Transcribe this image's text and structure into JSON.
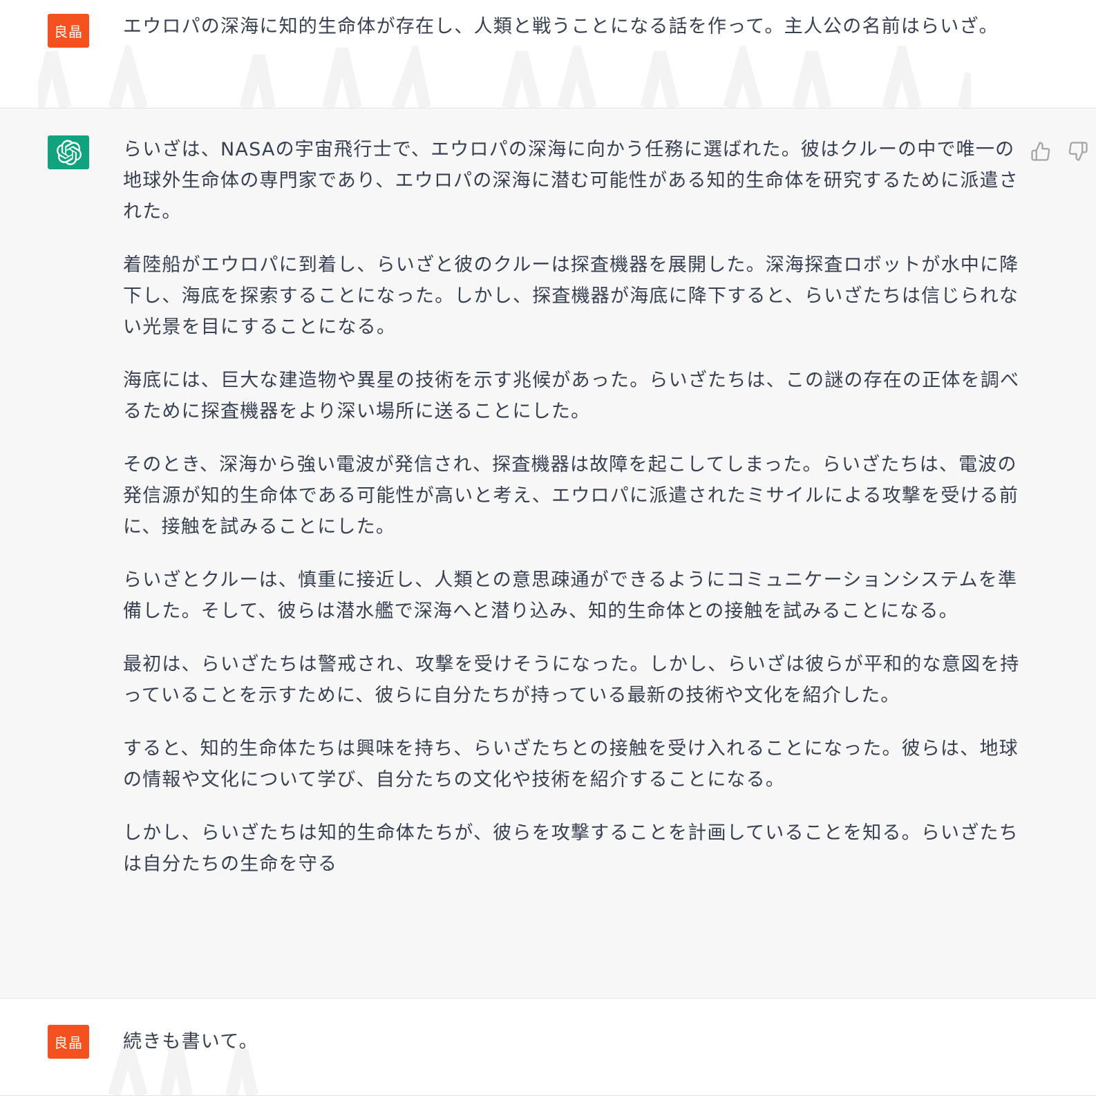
{
  "user_avatar_label": "良晶",
  "colors": {
    "user_avatar": "#f4511e",
    "assistant_avatar": "#10a37f",
    "assistant_bg": "#f7f7f8",
    "text": "#374151"
  },
  "messages": [
    {
      "role": "user",
      "text": "エウロパの深海に知的生命体が存在し、人類と戦うことになる話を作って。主人公の名前はらいざ。"
    },
    {
      "role": "assistant",
      "paragraphs": [
        "らいざは、NASAの宇宙飛行士で、エウロパの深海に向かう任務に選ばれた。彼はクルーの中で唯一の地球外生命体の専門家であり、エウロパの深海に潜む可能性がある知的生命体を研究するために派遣された。",
        "着陸船がエウロパに到着し、らいざと彼のクルーは探査機器を展開した。深海探査ロボットが水中に降下し、海底を探索することになった。しかし、探査機器が海底に降下すると、らいざたちは信じられない光景を目にすることになる。",
        "海底には、巨大な建造物や異星の技術を示す兆候があった。らいざたちは、この謎の存在の正体を調べるために探査機器をより深い場所に送ることにした。",
        "そのとき、深海から強い電波が発信され、探査機器は故障を起こしてしまった。らいざたちは、電波の発信源が知的生命体である可能性が高いと考え、エウロパに派遣されたミサイルによる攻撃を受ける前に、接触を試みることにした。",
        "らいざとクルーは、慎重に接近し、人類との意思疎通ができるようにコミュニケーションシステムを準備した。そして、彼らは潜水艦で深海へと潜り込み、知的生命体との接触を試みることになる。",
        "最初は、らいざたちは警戒され、攻撃を受けそうになった。しかし、らいざは彼らが平和的な意図を持っていることを示すために、彼らに自分たちが持っている最新の技術や文化を紹介した。",
        "すると、知的生命体たちは興味を持ち、らいざたちとの接触を受け入れることになった。彼らは、地球の情報や文化について学び、自分たちの文化や技術を紹介することになる。",
        "しかし、らいざたちは知的生命体たちが、彼らを攻撃することを計画していることを知る。らいざたちは自分たちの生命を守る"
      ]
    },
    {
      "role": "user",
      "text": "続きも書いて。"
    }
  ]
}
